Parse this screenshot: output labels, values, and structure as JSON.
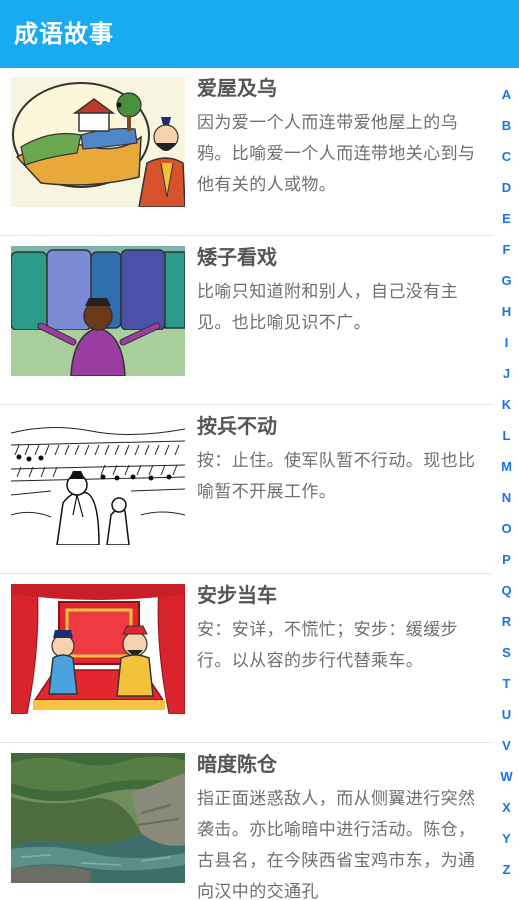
{
  "app": {
    "title": "成语故事"
  },
  "idioms": [
    {
      "title": "爱屋及乌",
      "description": "因为爱一个人而连带爱他屋上的乌鸦。比喻爱一个人而连带地关心到与他有关的人或物。",
      "image": "house-crow-illustration"
    },
    {
      "title": "矮子看戏",
      "description": "比喻只知道附和别人，自己没有主见。也比喻见识不广。",
      "image": "short-man-watching-play-illustration"
    },
    {
      "title": "按兵不动",
      "description": "按：止住。使军队暂不行动。现也比喻暂不开展工作。",
      "image": "army-halted-sketch"
    },
    {
      "title": "安步当车",
      "description": "安：安详，不慌忙；安步：缓缓步行。以从容的步行代替乘车。",
      "image": "stage-two-officials-illustration"
    },
    {
      "title": "暗度陈仓",
      "description": "指正面迷惑敌人，而从侧翼进行突然袭击。亦比喻暗中进行活动。陈仓，古县名，在今陕西省宝鸡市东，为通向汉中的交通孔",
      "image": "mountain-river-photo"
    }
  ],
  "alphabet": [
    "A",
    "B",
    "C",
    "D",
    "E",
    "F",
    "G",
    "H",
    "I",
    "J",
    "K",
    "L",
    "M",
    "N",
    "O",
    "P",
    "Q",
    "R",
    "S",
    "T",
    "U",
    "V",
    "W",
    "X",
    "Y",
    "Z"
  ],
  "colors": {
    "app_bar": "#1aaaf3",
    "index_letter": "#1a73e8",
    "title_text": "#555555",
    "body_text": "#6f6f6f"
  }
}
